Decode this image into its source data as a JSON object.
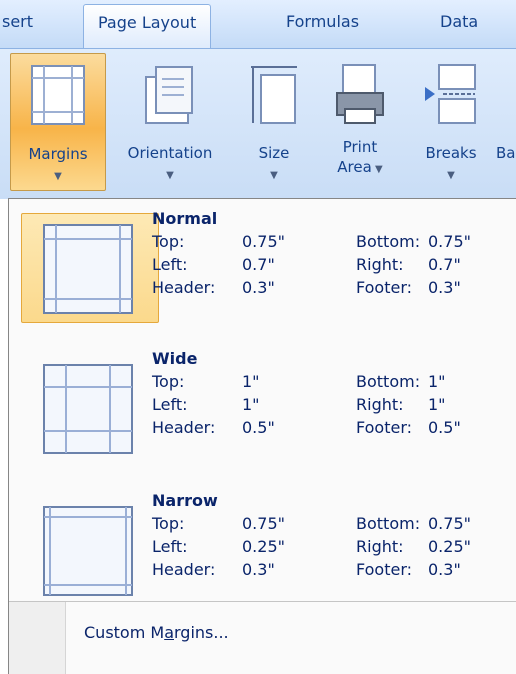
{
  "tabs": [
    "sert",
    "Page Layout",
    "Formulas",
    "Data"
  ],
  "ribbon": {
    "margins": "Margins",
    "orientation": "Orientation",
    "size": "Size",
    "print_area_line1": "Print",
    "print_area_line2": "Area",
    "breaks": "Breaks",
    "cut_off": "Ba"
  },
  "presets": [
    {
      "name": "Normal",
      "rows": [
        {
          "l_key": "Top:",
          "l_val": "0.75\"",
          "r_key": "Bottom:",
          "r_val": "0.75\""
        },
        {
          "l_key": "Left:",
          "l_val": "0.7\"",
          "r_key": "Right:",
          "r_val": "0.7\""
        },
        {
          "l_key": "Header:",
          "l_val": "0.3\"",
          "r_key": "Footer:",
          "r_val": "0.3\""
        }
      ]
    },
    {
      "name": "Wide",
      "rows": [
        {
          "l_key": "Top:",
          "l_val": "1\"",
          "r_key": "Bottom:",
          "r_val": "1\""
        },
        {
          "l_key": "Left:",
          "l_val": "1\"",
          "r_key": "Right:",
          "r_val": "1\""
        },
        {
          "l_key": "Header:",
          "l_val": "0.5\"",
          "r_key": "Footer:",
          "r_val": "0.5\""
        }
      ]
    },
    {
      "name": "Narrow",
      "rows": [
        {
          "l_key": "Top:",
          "l_val": "0.75\"",
          "r_key": "Bottom:",
          "r_val": "0.75\""
        },
        {
          "l_key": "Left:",
          "l_val": "0.25\"",
          "r_key": "Right:",
          "r_val": "0.25\""
        },
        {
          "l_key": "Header:",
          "l_val": "0.3\"",
          "r_key": "Footer:",
          "r_val": "0.3\""
        }
      ]
    }
  ],
  "custom": {
    "before": "Custom M",
    "accel": "a",
    "after": "rgins..."
  },
  "colors": {
    "accent": "#f8b449",
    "text": "#0a246a",
    "ribbon": "#c9ddf6"
  }
}
